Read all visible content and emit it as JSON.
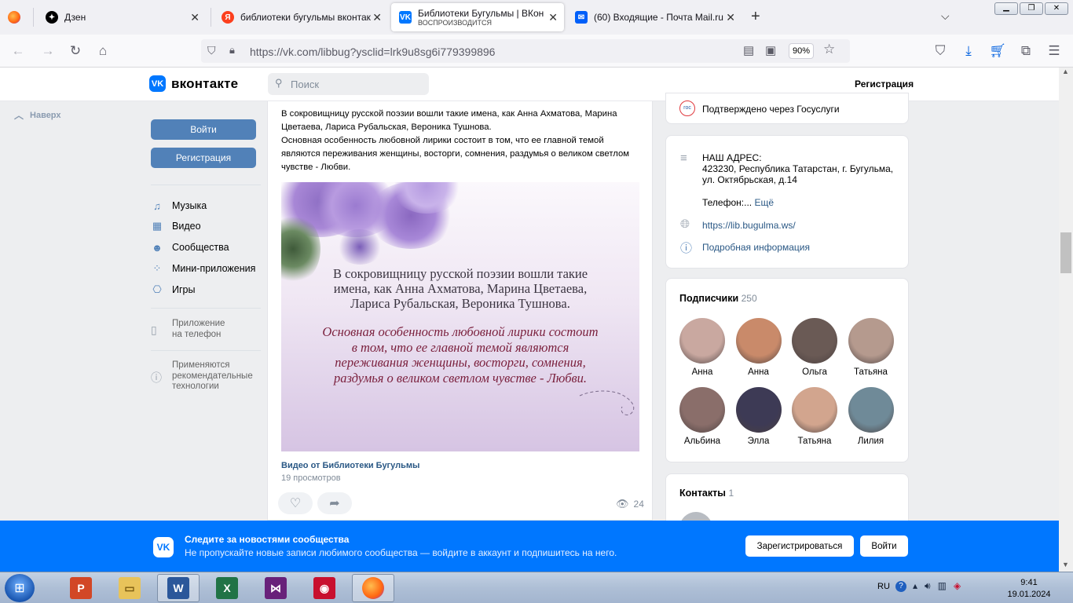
{
  "browser": {
    "tabs": [
      {
        "title": "Дзен",
        "color": "#000000"
      },
      {
        "title": "библиотеки бугульмы вконтак",
        "color": "#fc3f1d"
      },
      {
        "title": "Библиотеки Бугульмы | ВКонт",
        "subtitle": "ВОСПРОИЗВОДИТСЯ",
        "color": "#0077ff"
      },
      {
        "title": "(60) Входящие - Почта Mail.ru",
        "color": "#005ff9"
      }
    ],
    "url": "https://vk.com/libbug?ysclid=lrk9u8sg6i779399896",
    "zoom": "90%"
  },
  "vk": {
    "logo_text": "вконтакте",
    "search_placeholder": "Поиск",
    "register_top": "Регистрация",
    "back_to_top": "Наверх"
  },
  "left_menu": {
    "login": "Войти",
    "register": "Регистрация",
    "items": [
      {
        "label": "Музыка",
        "icon": "music-icon"
      },
      {
        "label": "Видео",
        "icon": "video-icon"
      },
      {
        "label": "Сообщества",
        "icon": "communities-icon"
      },
      {
        "label": "Мини-приложения",
        "icon": "apps-icon"
      },
      {
        "label": "Игры",
        "icon": "games-icon"
      }
    ],
    "app_line1": "Приложение",
    "app_line2": "на телефон",
    "rec_line1": "Применяются",
    "rec_line2": "рекомендательные",
    "rec_line3": "технологии"
  },
  "post": {
    "para1": "В сокровищницу русской поэзии вошли такие имена, как Анна Ахматова, Марина Цветаева, Лариса Рубальская, Вероника Тушнова.",
    "para2": "Основная особенность любовной лирики состоит в том, что ее главной темой являются переживания женщины, восторги, сомнения, раздумья о великом светлом чувстве - Любви.",
    "image_text1_l1": "В сокровищницу русской поэзии вошли такие",
    "image_text1_l2": "имена, как Анна Ахматова, Марина Цветаева,",
    "image_text1_l3": "Лариса Рубальская, Вероника Тушнова.",
    "image_text2_l1": "Основная особенность любовной лирики состоит",
    "image_text2_l2": "в том, что ее главной темой являются",
    "image_text2_l3": "переживания женщины, восторги, сомнения,",
    "image_text2_l4": "раздумья о великом светлом чувстве - Любви.",
    "video_title": "Видео от Библиотеки Бугульмы",
    "video_views": "19 просмотров",
    "view_count": "24"
  },
  "right": {
    "gosuslugi": "Подтверждено через Госуслуги",
    "address_title": "НАШ АДРЕС:",
    "address_line1": "423230, Республика Татарстан, г. Бугульма,",
    "address_line2": "ул. Октябрьская, д.14",
    "phone_label": "Телефон:...",
    "more": "Ещё",
    "site": "https://lib.bugulma.ws/",
    "details": "Подробная информация",
    "subscribers_title": "Подписчики",
    "subscribers_count": "250",
    "subscribers": [
      {
        "name": "Анна",
        "color": "#c9a8a0"
      },
      {
        "name": "Анна",
        "color": "#c98a6a"
      },
      {
        "name": "Ольга",
        "color": "#6a5a55"
      },
      {
        "name": "Татьяна",
        "color": "#b59a8e"
      },
      {
        "name": "Альбина",
        "color": "#8a6e6a"
      },
      {
        "name": "Элла",
        "color": "#3d3a55"
      },
      {
        "name": "Татьяна",
        "color": "#d2a58e"
      },
      {
        "name": "Лилия",
        "color": "#6f8a98"
      }
    ],
    "contacts_title": "Контакты",
    "contacts_count": "1"
  },
  "banner": {
    "title": "Следите за новостями сообщества",
    "subtitle": "Не пропускайте новые записи любимого сообщества — войдите в аккаунт и подпишитесь на него.",
    "register": "Зарегистрироваться",
    "login": "Войти"
  },
  "taskbar": {
    "lang": "RU",
    "time": "9:41",
    "date": "19.01.2024"
  }
}
